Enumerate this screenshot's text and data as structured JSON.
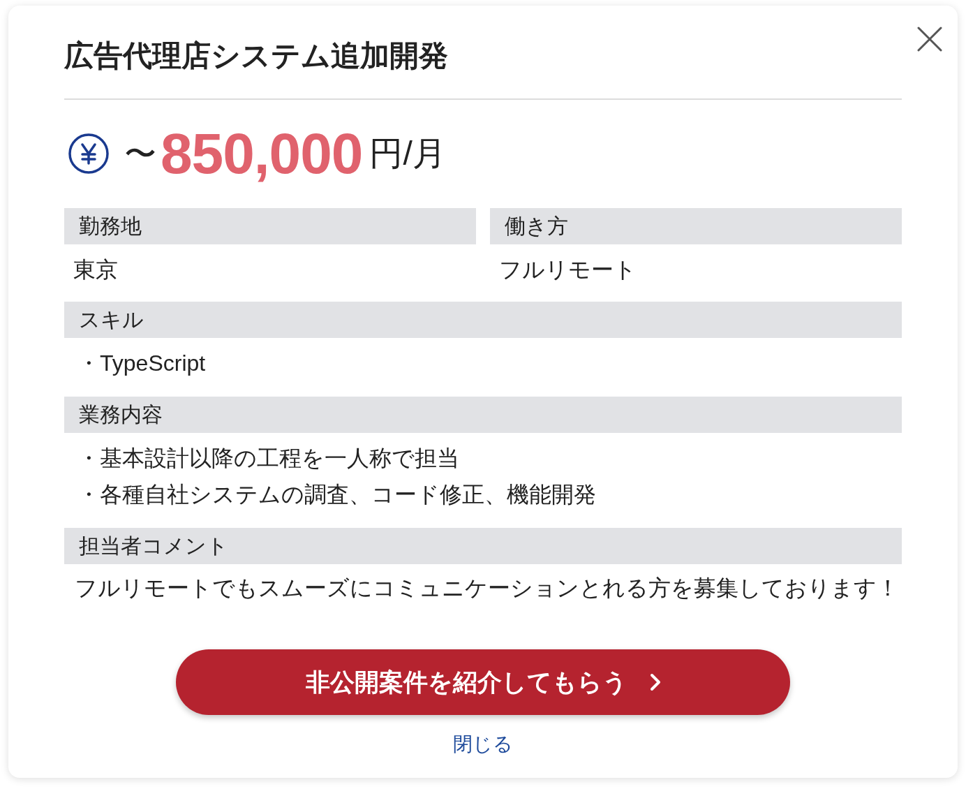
{
  "dialog": {
    "title": "広告代理店システム追加開発"
  },
  "salary": {
    "prefix": "〜",
    "amount": "850,000",
    "unit": "円/月"
  },
  "summary_fields": [
    {
      "label": "勤務地",
      "value": "東京"
    },
    {
      "label": "働き方",
      "value": "フルリモート"
    }
  ],
  "sections": [
    {
      "kind": "list",
      "label": "スキル",
      "items": [
        "・TypeScript"
      ]
    },
    {
      "kind": "list",
      "label": "業務内容",
      "items": [
        "・基本設計以降の工程を一人称で担当",
        "・各種自社システムの調査、コード修正、機能開発"
      ]
    },
    {
      "kind": "text",
      "label": "担当者コメント",
      "text": "フルリモートでもスムーズにコミュニケーションとれる方を募集しております！"
    }
  ],
  "primary_button": {
    "label": "非公開案件を紹介してもらう"
  },
  "close_link": {
    "label": "閉じる"
  }
}
